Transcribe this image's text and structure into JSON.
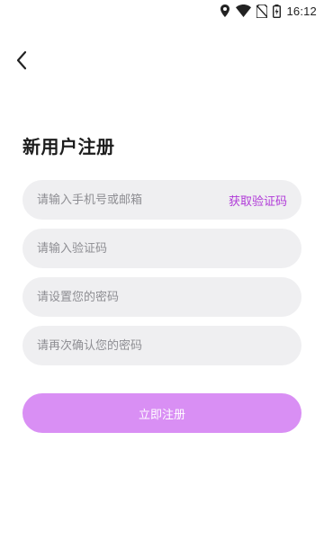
{
  "status_bar": {
    "time": "16:12",
    "icons": [
      "location-icon",
      "wifi-icon",
      "no-sim-icon",
      "battery-charging-icon"
    ]
  },
  "header": {
    "back_icon": "chevron-left-icon"
  },
  "title": "新用户注册",
  "form": {
    "account_placeholder": "请输入手机号或邮箱",
    "get_code_label": "获取验证码",
    "code_placeholder": "请输入验证码",
    "password_placeholder": "请设置您的密码",
    "confirm_placeholder": "请再次确认您的密码",
    "submit_label": "立即注册"
  },
  "colors": {
    "accent": "#b03ad8",
    "button": "#d98ff4",
    "field_bg": "#efeff1"
  }
}
